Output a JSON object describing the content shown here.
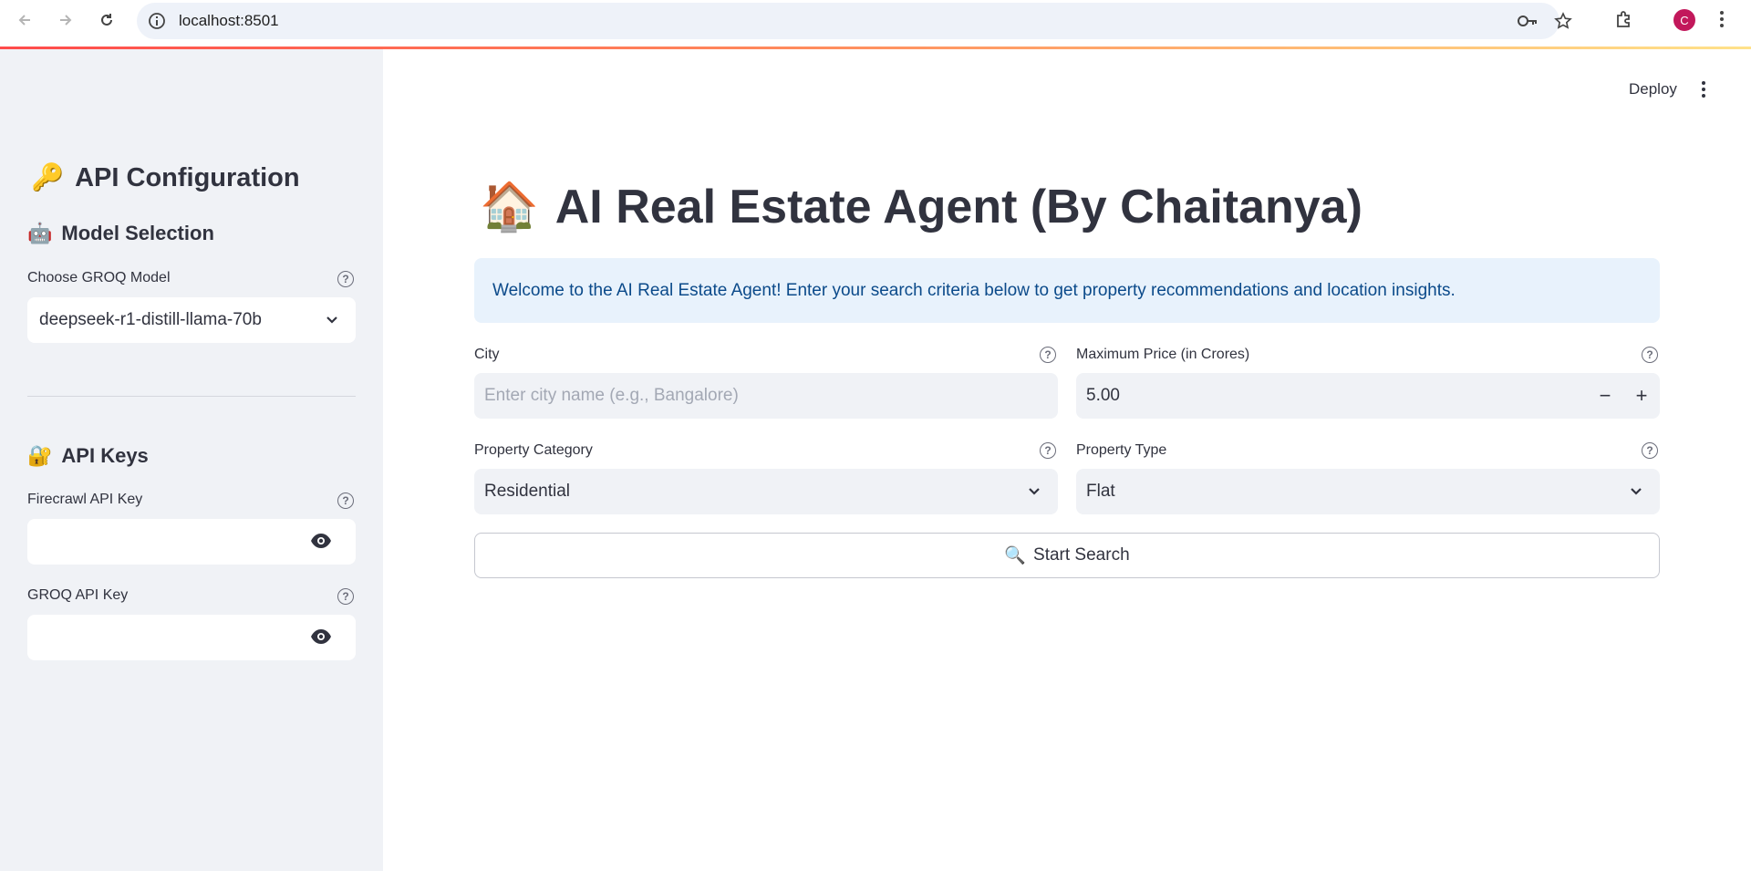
{
  "browser": {
    "url": "localhost:8501",
    "avatar_letter": "C"
  },
  "sidebar": {
    "title": "API Configuration",
    "title_icon": "🔑",
    "model_section": {
      "heading": "Model Selection",
      "icon": "🤖",
      "label": "Choose GROQ Model",
      "selected": "deepseek-r1-distill-llama-70b"
    },
    "keys_section": {
      "heading": "API Keys",
      "icon": "🔐",
      "firecrawl_label": "Firecrawl API Key",
      "firecrawl_value": "",
      "groq_label": "GROQ API Key",
      "groq_value": ""
    }
  },
  "header": {
    "deploy_label": "Deploy"
  },
  "main": {
    "title": "AI Real Estate Agent (By Chaitanya)",
    "title_icon": "🏠",
    "info": "Welcome to the AI Real Estate Agent! Enter your search criteria below to get property recommendations and location insights.",
    "city_label": "City",
    "city_placeholder": "Enter city name (e.g., Bangalore)",
    "price_label": "Maximum Price (in Crores)",
    "price_value": "5.00",
    "category_label": "Property Category",
    "category_value": "Residential",
    "type_label": "Property Type",
    "type_value": "Flat",
    "search_label": "Start Search",
    "search_icon": "🔍"
  },
  "colors": {
    "accent_red": "#ff4b4b",
    "sidebar_bg": "#f0f2f6",
    "info_bg": "#e8f2fc",
    "info_text": "#0b4a8a"
  }
}
